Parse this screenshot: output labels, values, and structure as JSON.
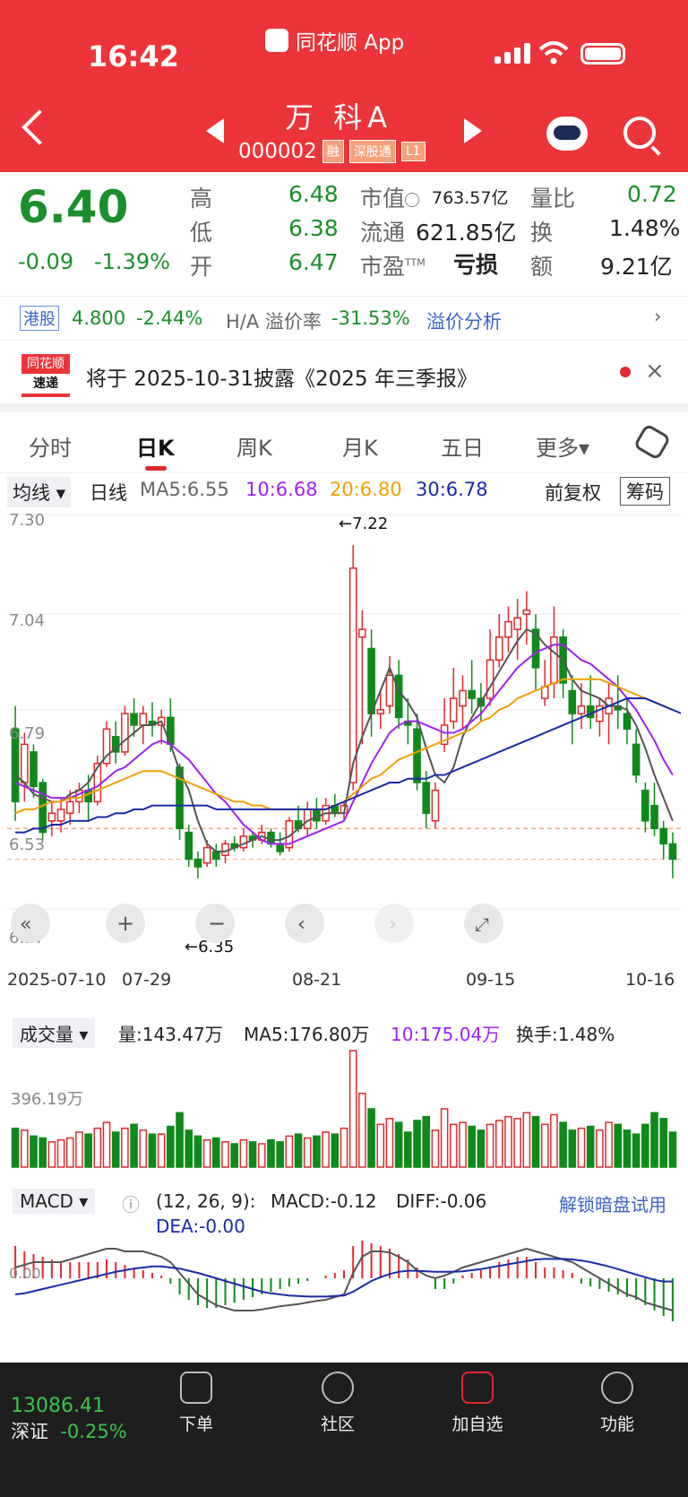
{
  "status": {
    "time": "16:42",
    "app": "同花顺 App"
  },
  "stock": {
    "name": "万 科A",
    "code": "000002",
    "tags": [
      "融",
      "深股通",
      "L1"
    ]
  },
  "quote": {
    "price": "6.40",
    "change": "-0.09",
    "change_pct": "-1.39%",
    "high_label": "高",
    "high": "6.48",
    "low_label": "低",
    "low": "6.38",
    "open_label": "开",
    "open": "6.47",
    "mcap_label": "市值",
    "mcap": "763.57亿",
    "float_label": "流通",
    "float": "621.85亿",
    "pe_label": "市盈",
    "pe_suffix": "TTM",
    "pe": "亏损",
    "vr_label": "量比",
    "vr": "0.72",
    "turnover_label": "换",
    "turnover": "1.48%",
    "amount_label": "额",
    "amount": "9.21亿"
  },
  "hk": {
    "badge": "港股",
    "price": "4.800",
    "pct": "-2.44%",
    "premium_label": "H/A 溢价率",
    "premium": "-31.53%",
    "link": "溢价分析"
  },
  "news": {
    "logo_top": "同花顺",
    "logo_bottom": "速递",
    "text": "将于 2025-10-31披露《2025 年三季报》"
  },
  "tabs": [
    "分时",
    "日K",
    "周K",
    "月K",
    "五日",
    "更多▾"
  ],
  "ma_bar": {
    "dropdown": "均线 ▾",
    "type": "日线",
    "ma5": "MA5:6.55",
    "ma10": "10:6.68",
    "ma20": "20:6.80",
    "ma30": "30:6.78",
    "adj": "前复权",
    "chip": "筹码"
  },
  "kchart": {
    "y_labels": [
      "7.30",
      "7.04",
      "6.79",
      "6.53",
      "6.27"
    ],
    "high_note": "←7.22",
    "low_note": "←6.35",
    "x_labels": [
      "2025-07-10",
      "07-29",
      "08-21",
      "09-15",
      "10-16"
    ]
  },
  "volume": {
    "dropdown": "成交量 ▾",
    "vol": "量:143.47万",
    "ma5": "MA5:176.80万",
    "ma10": "10:175.04万",
    "turnover": "换手:1.48%",
    "y_label": "396.19万"
  },
  "macd": {
    "dropdown": "MACD ▾",
    "params": "(12, 26, 9):",
    "macd": "MACD:-0.12",
    "diff": "DIFF:-0.06",
    "dea": "DEA:-0.00",
    "unlock": "解锁暗盘试用",
    "zero": "0.00"
  },
  "nav": {
    "index_value": "13086.41",
    "index_name": "深证",
    "index_pct": "-0.25%",
    "order": "下单",
    "community": "社区",
    "add": "加自选",
    "func": "功能"
  },
  "chart_data": {
    "type": "candlestick",
    "ylim": [
      6.27,
      7.3
    ],
    "candles": [
      [
        6.74,
        6.8,
        6.5,
        6.55
      ],
      [
        6.6,
        6.73,
        6.55,
        6.7
      ],
      [
        6.68,
        6.7,
        6.56,
        6.59
      ],
      [
        6.6,
        6.61,
        6.45,
        6.47
      ],
      [
        6.5,
        6.55,
        6.46,
        6.52
      ],
      [
        6.5,
        6.56,
        6.47,
        6.53
      ],
      [
        6.52,
        6.58,
        6.49,
        6.55
      ],
      [
        6.55,
        6.6,
        6.52,
        6.58
      ],
      [
        6.58,
        6.62,
        6.5,
        6.55
      ],
      [
        6.55,
        6.67,
        6.54,
        6.65
      ],
      [
        6.65,
        6.76,
        6.64,
        6.74
      ],
      [
        6.72,
        6.76,
        6.65,
        6.68
      ],
      [
        6.68,
        6.8,
        6.67,
        6.78
      ],
      [
        6.78,
        6.82,
        6.72,
        6.75
      ],
      [
        6.75,
        6.8,
        6.7,
        6.78
      ],
      [
        6.76,
        6.81,
        6.72,
        6.75
      ],
      [
        6.75,
        6.79,
        6.7,
        6.77
      ],
      [
        6.77,
        6.82,
        6.68,
        6.7
      ],
      [
        6.64,
        6.65,
        6.45,
        6.48
      ],
      [
        6.47,
        6.49,
        6.38,
        6.4
      ],
      [
        6.4,
        6.42,
        6.35,
        6.38
      ],
      [
        6.39,
        6.45,
        6.38,
        6.43
      ],
      [
        6.42,
        6.44,
        6.38,
        6.4
      ],
      [
        6.41,
        6.45,
        6.39,
        6.44
      ],
      [
        6.44,
        6.46,
        6.42,
        6.43
      ],
      [
        6.43,
        6.48,
        6.42,
        6.46
      ],
      [
        6.46,
        6.47,
        6.43,
        6.45
      ],
      [
        6.45,
        6.49,
        6.44,
        6.47
      ],
      [
        6.47,
        6.48,
        6.43,
        6.44
      ],
      [
        6.44,
        6.47,
        6.41,
        6.42
      ],
      [
        6.43,
        6.51,
        6.42,
        6.5
      ],
      [
        6.5,
        6.54,
        6.47,
        6.48
      ],
      [
        6.48,
        6.55,
        6.46,
        6.53
      ],
      [
        6.53,
        6.56,
        6.48,
        6.5
      ],
      [
        6.5,
        6.56,
        6.49,
        6.54
      ],
      [
        6.54,
        6.57,
        6.51,
        6.52
      ],
      [
        6.52,
        6.55,
        6.5,
        6.54
      ],
      [
        6.6,
        7.22,
        6.58,
        7.16
      ],
      [
        6.98,
        7.05,
        6.7,
        7.0
      ],
      [
        6.95,
        7.0,
        6.72,
        6.78
      ],
      [
        6.78,
        6.84,
        6.74,
        6.79
      ],
      [
        6.8,
        6.93,
        6.78,
        6.88
      ],
      [
        6.88,
        6.92,
        6.74,
        6.77
      ],
      [
        6.76,
        6.82,
        6.7,
        6.75
      ],
      [
        6.74,
        6.78,
        6.58,
        6.6
      ],
      [
        6.6,
        6.63,
        6.48,
        6.52
      ],
      [
        6.5,
        6.6,
        6.48,
        6.58
      ],
      [
        6.7,
        6.82,
        6.68,
        6.75
      ],
      [
        6.76,
        6.9,
        6.74,
        6.82
      ],
      [
        6.8,
        6.88,
        6.74,
        6.84
      ],
      [
        6.84,
        6.92,
        6.78,
        6.82
      ],
      [
        6.82,
        6.86,
        6.76,
        6.8
      ],
      [
        6.82,
        7.0,
        6.8,
        6.92
      ],
      [
        6.92,
        7.04,
        6.9,
        6.98
      ],
      [
        6.98,
        7.06,
        6.94,
        7.02
      ],
      [
        7.0,
        7.08,
        6.92,
        7.03
      ],
      [
        7.04,
        7.1,
        6.96,
        7.05
      ],
      [
        7.0,
        7.04,
        6.84,
        6.9
      ],
      [
        6.82,
        6.92,
        6.8,
        6.85
      ],
      [
        6.86,
        7.06,
        6.82,
        6.98
      ],
      [
        6.98,
        7.0,
        6.82,
        6.86
      ],
      [
        6.84,
        6.88,
        6.7,
        6.78
      ],
      [
        6.78,
        6.86,
        6.74,
        6.8
      ],
      [
        6.8,
        6.88,
        6.74,
        6.77
      ],
      [
        6.76,
        6.82,
        6.72,
        6.8
      ],
      [
        6.78,
        6.86,
        6.7,
        6.82
      ],
      [
        6.8,
        6.88,
        6.74,
        6.79
      ],
      [
        6.78,
        6.82,
        6.7,
        6.74
      ],
      [
        6.7,
        6.74,
        6.6,
        6.62
      ],
      [
        6.58,
        6.6,
        6.47,
        6.5
      ],
      [
        6.54,
        6.6,
        6.46,
        6.48
      ],
      [
        6.48,
        6.5,
        6.4,
        6.44
      ],
      [
        6.44,
        6.47,
        6.35,
        6.4
      ]
    ],
    "ma5": [
      6.62,
      6.6,
      6.57,
      6.56,
      6.55,
      6.55,
      6.57,
      6.58,
      6.6,
      6.64,
      6.67,
      6.69,
      6.71,
      6.73,
      6.75,
      6.75,
      6.76,
      6.7,
      6.63,
      6.58,
      6.5,
      6.44,
      6.42,
      6.42,
      6.43,
      6.44,
      6.45,
      6.46,
      6.45,
      6.45,
      6.46,
      6.48,
      6.5,
      6.51,
      6.52,
      6.52,
      6.52,
      6.65,
      6.72,
      6.78,
      6.84,
      6.9,
      6.84,
      6.81,
      6.77,
      6.69,
      6.62,
      6.6,
      6.64,
      6.72,
      6.77,
      6.81,
      6.85,
      6.89,
      6.93,
      6.97,
      7.0,
      6.99,
      6.96,
      6.94,
      6.92,
      6.87,
      6.84,
      6.83,
      6.82,
      6.8,
      6.8,
      6.79,
      6.75,
      6.69,
      6.62,
      6.56,
      6.5
    ],
    "ma10": [
      6.6,
      6.59,
      6.58,
      6.57,
      6.56,
      6.56,
      6.56,
      6.57,
      6.58,
      6.59,
      6.61,
      6.63,
      6.64,
      6.66,
      6.68,
      6.7,
      6.71,
      6.7,
      6.68,
      6.66,
      6.63,
      6.6,
      6.57,
      6.55,
      6.52,
      6.49,
      6.47,
      6.45,
      6.44,
      6.44,
      6.44,
      6.45,
      6.46,
      6.47,
      6.48,
      6.49,
      6.5,
      6.55,
      6.6,
      6.65,
      6.69,
      6.73,
      6.75,
      6.76,
      6.76,
      6.75,
      6.74,
      6.73,
      6.73,
      6.74,
      6.76,
      6.78,
      6.81,
      6.84,
      6.87,
      6.9,
      6.92,
      6.94,
      6.95,
      6.96,
      6.96,
      6.94,
      6.92,
      6.91,
      6.89,
      6.87,
      6.85,
      6.82,
      6.79,
      6.75,
      6.71,
      6.66,
      6.62
    ],
    "ma20": [
      6.52,
      6.53,
      6.53,
      6.54,
      6.55,
      6.55,
      6.56,
      6.56,
      6.57,
      6.58,
      6.59,
      6.6,
      6.61,
      6.62,
      6.63,
      6.63,
      6.63,
      6.62,
      6.61,
      6.6,
      6.59,
      6.58,
      6.57,
      6.56,
      6.55,
      6.55,
      6.54,
      6.54,
      6.53,
      6.53,
      6.53,
      6.53,
      6.53,
      6.53,
      6.53,
      6.54,
      6.55,
      6.57,
      6.59,
      6.61,
      6.62,
      6.64,
      6.66,
      6.67,
      6.68,
      6.69,
      6.7,
      6.71,
      6.72,
      6.73,
      6.74,
      6.76,
      6.77,
      6.79,
      6.8,
      6.82,
      6.83,
      6.84,
      6.85,
      6.86,
      6.87,
      6.87,
      6.87,
      6.87,
      6.87,
      6.86,
      6.85,
      6.84,
      6.83,
      6.82,
      6.81,
      6.8,
      6.79
    ],
    "ma30": [
      6.47,
      6.47,
      6.48,
      6.48,
      6.49,
      6.49,
      6.5,
      6.5,
      6.5,
      6.51,
      6.51,
      6.52,
      6.52,
      6.53,
      6.53,
      6.54,
      6.54,
      6.54,
      6.54,
      6.54,
      6.54,
      6.54,
      6.53,
      6.53,
      6.53,
      6.53,
      6.53,
      6.53,
      6.53,
      6.53,
      6.53,
      6.53,
      6.53,
      6.53,
      6.53,
      6.54,
      6.55,
      6.56,
      6.57,
      6.58,
      6.59,
      6.6,
      6.6,
      6.61,
      6.61,
      6.61,
      6.62,
      6.62,
      6.63,
      6.64,
      6.65,
      6.66,
      6.67,
      6.68,
      6.69,
      6.7,
      6.71,
      6.72,
      6.73,
      6.74,
      6.75,
      6.76,
      6.77,
      6.78,
      6.79,
      6.8,
      6.81,
      6.82,
      6.82,
      6.82,
      6.81,
      6.8,
      6.79,
      6.78
    ],
    "volume_max": 600,
    "volumes": [
      200,
      190,
      160,
      150,
      130,
      140,
      150,
      180,
      170,
      200,
      230,
      180,
      200,
      220,
      190,
      170,
      170,
      210,
      280,
      190,
      160,
      140,
      150,
      130,
      120,
      140,
      130,
      120,
      140,
      130,
      160,
      170,
      150,
      160,
      180,
      170,
      200,
      600,
      380,
      300,
      220,
      250,
      230,
      180,
      240,
      260,
      190,
      300,
      220,
      230,
      210,
      190,
      220,
      240,
      260,
      250,
      280,
      260,
      220,
      270,
      230,
      190,
      200,
      210,
      190,
      230,
      220,
      190,
      170,
      220,
      280,
      250,
      180
    ],
    "macd_bars": [
      0.06,
      0.05,
      0.045,
      0.04,
      0.035,
      0.03,
      0.03,
      0.03,
      0.03,
      0.03,
      0.035,
      0.03,
      0.025,
      0.02,
      0.015,
      0.01,
      0.005,
      -0.01,
      -0.03,
      -0.04,
      -0.05,
      -0.055,
      -0.055,
      -0.05,
      -0.045,
      -0.04,
      -0.035,
      -0.03,
      -0.025,
      -0.02,
      -0.015,
      -0.01,
      -0.005,
      0.0,
      0.005,
      0.01,
      0.015,
      0.06,
      0.07,
      0.065,
      0.06,
      0.055,
      0.045,
      0.035,
      0.02,
      0.0,
      -0.02,
      -0.02,
      -0.01,
      0.005,
      0.01,
      0.015,
      0.02,
      0.03,
      0.035,
      0.04,
      0.04,
      0.03,
      0.02,
      0.02,
      0.015,
      0.01,
      -0.01,
      -0.015,
      -0.02,
      -0.025,
      -0.03,
      -0.035,
      -0.04,
      -0.05,
      -0.06,
      -0.07,
      -0.08
    ],
    "diff": [
      0.02,
      0.025,
      0.03,
      0.03,
      0.03,
      0.03,
      0.035,
      0.04,
      0.045,
      0.05,
      0.055,
      0.055,
      0.05,
      0.05,
      0.05,
      0.045,
      0.04,
      0.03,
      0.01,
      -0.01,
      -0.03,
      -0.04,
      -0.05,
      -0.055,
      -0.06,
      -0.06,
      -0.06,
      -0.058,
      -0.055,
      -0.052,
      -0.05,
      -0.048,
      -0.045,
      -0.042,
      -0.04,
      -0.035,
      -0.03,
      0.01,
      0.04,
      0.05,
      0.05,
      0.048,
      0.04,
      0.03,
      0.015,
      0.005,
      0.0,
      0.005,
      0.012,
      0.02,
      0.025,
      0.03,
      0.035,
      0.04,
      0.045,
      0.05,
      0.055,
      0.05,
      0.045,
      0.04,
      0.035,
      0.03,
      0.02,
      0.01,
      0.0,
      -0.01,
      -0.02,
      -0.03,
      -0.035,
      -0.045,
      -0.05,
      -0.055,
      -0.06
    ],
    "dea": [
      -0.03,
      -0.028,
      -0.024,
      -0.02,
      -0.016,
      -0.012,
      -0.008,
      -0.004,
      0.0,
      0.004,
      0.008,
      0.012,
      0.015,
      0.018,
      0.02,
      0.022,
      0.022,
      0.02,
      0.018,
      0.014,
      0.01,
      0.005,
      0.0,
      -0.005,
      -0.01,
      -0.015,
      -0.02,
      -0.025,
      -0.028,
      -0.03,
      -0.032,
      -0.033,
      -0.034,
      -0.034,
      -0.034,
      -0.033,
      -0.032,
      -0.025,
      -0.015,
      -0.005,
      0.002,
      0.008,
      0.012,
      0.014,
      0.014,
      0.013,
      0.012,
      0.012,
      0.012,
      0.013,
      0.015,
      0.017,
      0.02,
      0.023,
      0.026,
      0.029,
      0.032,
      0.035,
      0.036,
      0.036,
      0.036,
      0.035,
      0.033,
      0.03,
      0.026,
      0.022,
      0.017,
      0.012,
      0.007,
      0.002,
      -0.003,
      -0.006,
      -0.006
    ]
  }
}
